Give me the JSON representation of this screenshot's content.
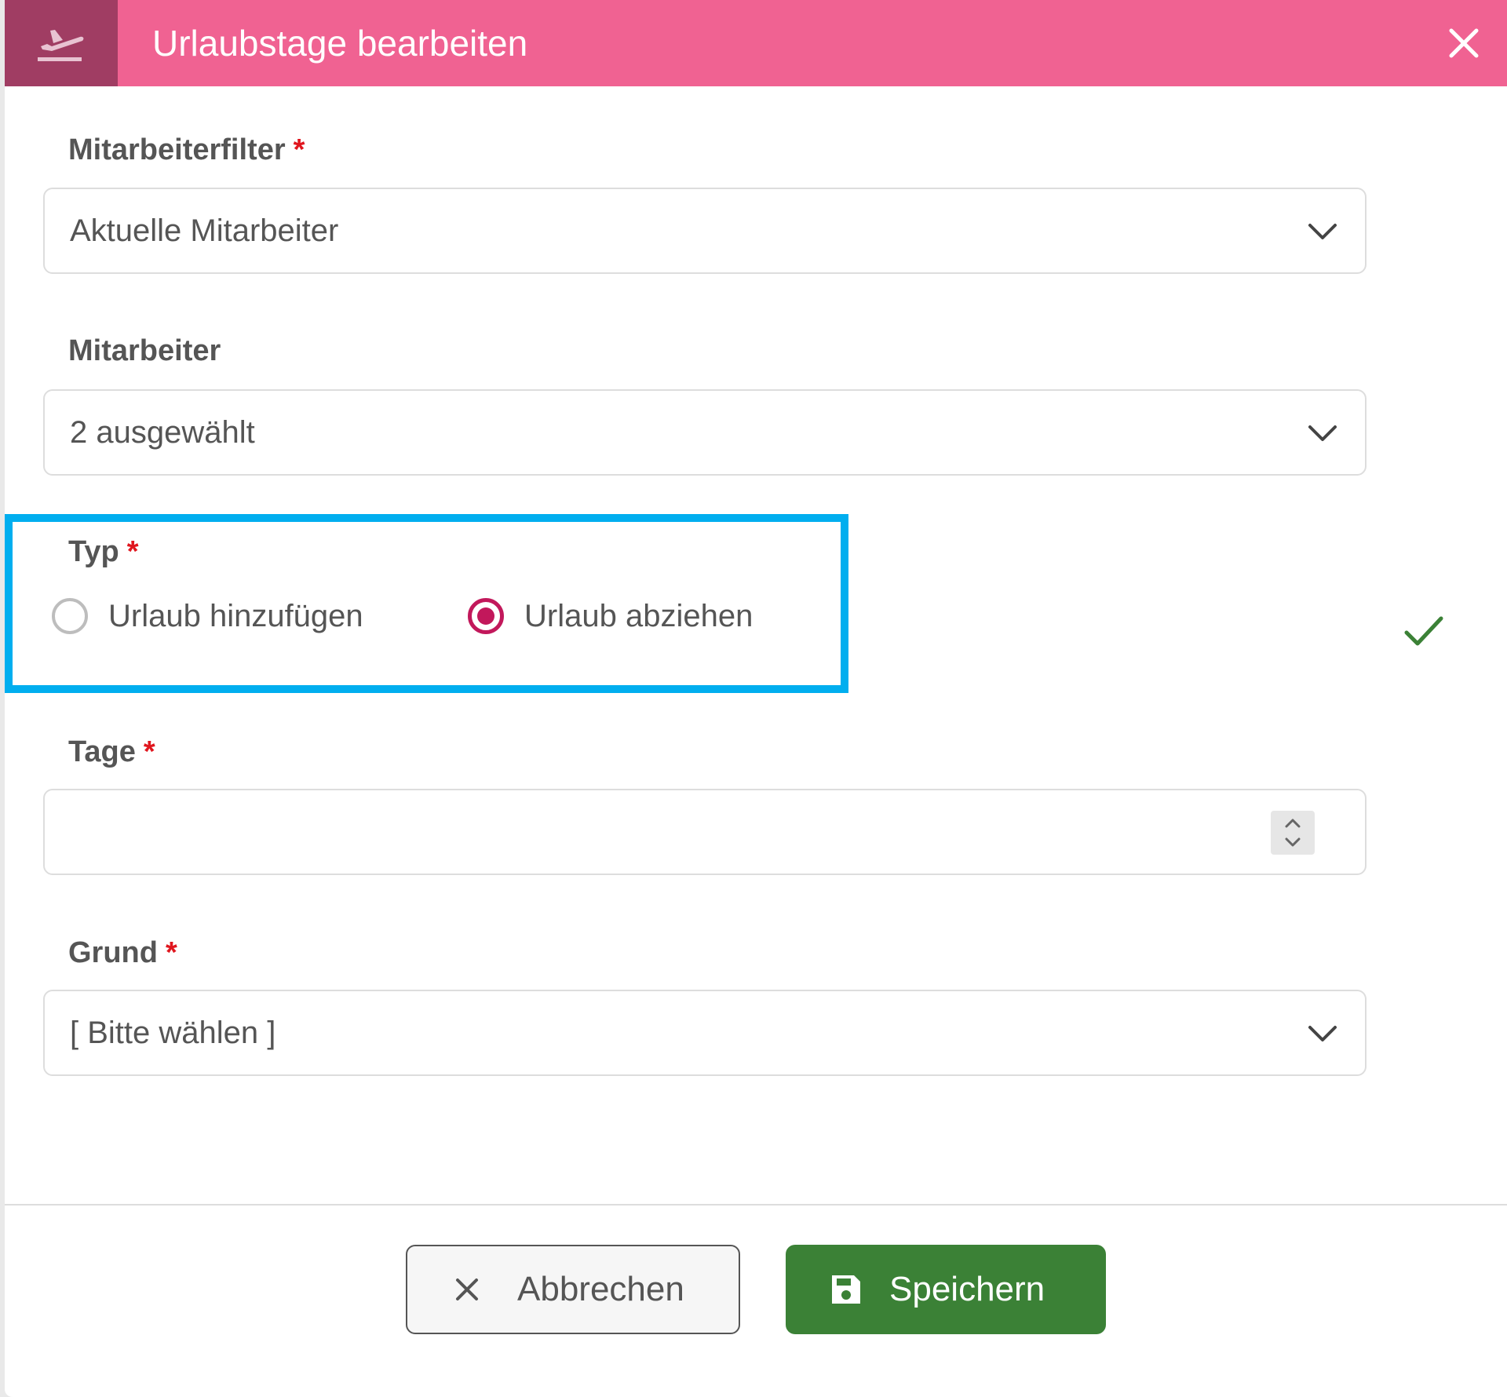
{
  "dialog": {
    "title": "Urlaubstage bearbeiten",
    "title_icon": "plane-departure-icon",
    "close_icon": "close-icon",
    "header_color": "#f06292",
    "header_icon_bg": "#a03d63"
  },
  "fields": {
    "employee_filter": {
      "label": "Mitarbeiterfilter",
      "required_mark": "*",
      "value": "Aktuelle Mitarbeiter"
    },
    "employee": {
      "label": "Mitarbeiter",
      "value": "2 ausgewählt"
    },
    "type": {
      "label": "Typ",
      "required_mark": "*",
      "options": [
        {
          "label": "Urlaub hinzufügen",
          "selected": false
        },
        {
          "label": "Urlaub abziehen",
          "selected": true
        }
      ]
    },
    "days": {
      "label": "Tage",
      "required_mark": "*",
      "value": ""
    },
    "reason": {
      "label": "Grund",
      "required_mark": "*",
      "value": "[ Bitte wählen ]"
    }
  },
  "buttons": {
    "cancel": {
      "label": "Abbrechen",
      "icon": "close-icon"
    },
    "save": {
      "label": "Speichern",
      "icon": "floppy-disk-icon",
      "color": "#3b8136"
    }
  },
  "colors": {
    "radio_selected": "#c2185b",
    "required": "#e0161e",
    "highlight": "#00aeef",
    "valid_check": "#3b8136"
  }
}
